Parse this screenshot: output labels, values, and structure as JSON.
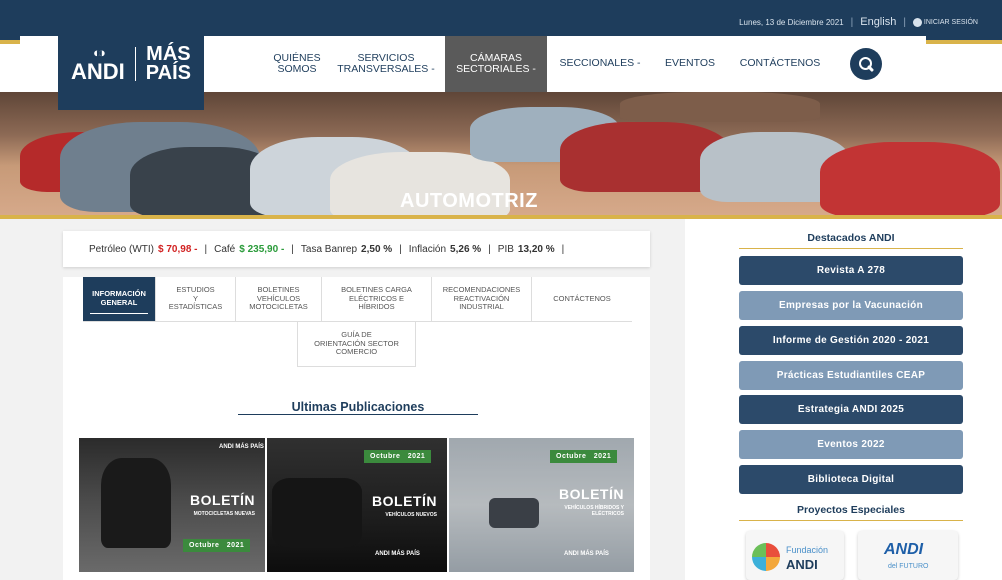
{
  "topbar": {
    "date": "Lunes, 13 de Diciembre 2021",
    "language": "English",
    "login": "INICIAR SESIÓN"
  },
  "logo": {
    "left": "ANDI",
    "right_top": "MÁS",
    "right_bottom": "PAÍS"
  },
  "nav": {
    "items": [
      {
        "label_1": "QUIÉNES",
        "label_2": "SOMOS"
      },
      {
        "label_1": "SERVICIOS",
        "label_2": "TRANSVERSALES -"
      },
      {
        "label_1": "CÁMARAS",
        "label_2": "SECTORIALES -"
      },
      {
        "label_1": "SECCIONALES -",
        "label_2": ""
      },
      {
        "label_1": "EVENTOS",
        "label_2": ""
      },
      {
        "label_1": "CONTÁCTENOS",
        "label_2": ""
      }
    ],
    "active_index": 2
  },
  "hero": {
    "title": "AUTOMOTRIZ"
  },
  "ticker": {
    "oil_label": "Petróleo (WTI)",
    "oil_value": "$ 70,98 -",
    "coffee_label": "Café",
    "coffee_value": "$ 235,90 -",
    "rate_label": "Tasa Banrep",
    "rate_value": "2,50 %",
    "inflation_label": "Inflación",
    "inflation_value": "5,26 %",
    "pib_label": "PIB",
    "pib_value": "13,20 %",
    "separator": "|"
  },
  "tabs": [
    {
      "l1": "INFORMACIÓN",
      "l2": "GENERAL",
      "l3": "",
      "active": true
    },
    {
      "l1": "ESTUDIOS",
      "l2": "Y",
      "l3": "ESTADÍSTICAS"
    },
    {
      "l1": "BOLETINES",
      "l2": "VEHÍCULOS",
      "l3": "MOTOCICLETAS"
    },
    {
      "l1": "BOLETINES CARGA",
      "l2": "ELÉCTRICOS E",
      "l3": "HÍBRIDOS"
    },
    {
      "l1": "RECOMENDACIONES",
      "l2": "REACTIVACIÓN",
      "l3": "INDUSTRIAL"
    },
    {
      "l1": "CONTÁCTENOS",
      "l2": "",
      "l3": ""
    },
    {
      "l1": "GUÍA DE",
      "l2": "ORIENTACIÓN SECTOR",
      "l3": "COMERCIO"
    }
  ],
  "publications": {
    "heading": "Ultimas Publicaciones",
    "cards": [
      {
        "title": "BOLETÍN",
        "subtitle": "MOTOCICLETAS NUEVAS",
        "month": "Octubre",
        "year": "2021"
      },
      {
        "title": "BOLETÍN",
        "subtitle": "VEHÍCULOS NUEVOS",
        "month": "Octubre",
        "year": "2021"
      },
      {
        "title": "BOLETÍN",
        "subtitle": "VEHÍCULOS HÍBRIDOS Y ELÉCTRICOS",
        "month": "Octubre",
        "year": "2021"
      }
    ]
  },
  "sidebar": {
    "heading": "Destacados ANDI",
    "buttons": [
      {
        "label": "Revista A 278",
        "style": "dark"
      },
      {
        "label": "Empresas por la Vacunación",
        "style": "light"
      },
      {
        "label": "Informe de Gestión 2020 - 2021",
        "style": "dark"
      },
      {
        "label": "Prácticas Estudiantiles CEAP",
        "style": "light"
      },
      {
        "label": "Estrategia ANDI 2025",
        "style": "dark"
      },
      {
        "label": "Eventos 2022",
        "style": "light"
      },
      {
        "label": "Biblioteca Digital",
        "style": "dark"
      }
    ],
    "projects_heading": "Proyectos Especiales",
    "projects": [
      {
        "line1": "Fundación",
        "line2": "ANDI"
      },
      {
        "line1": "ANDI",
        "line2": "del FUTURO"
      }
    ]
  },
  "colors": {
    "navy": "#1e3d5c",
    "gold": "#d9b34a",
    "button_dark": "#2c4a6a",
    "button_light": "#7f9ab6",
    "price_red": "#d22222",
    "price_green": "#2a9b3a"
  }
}
